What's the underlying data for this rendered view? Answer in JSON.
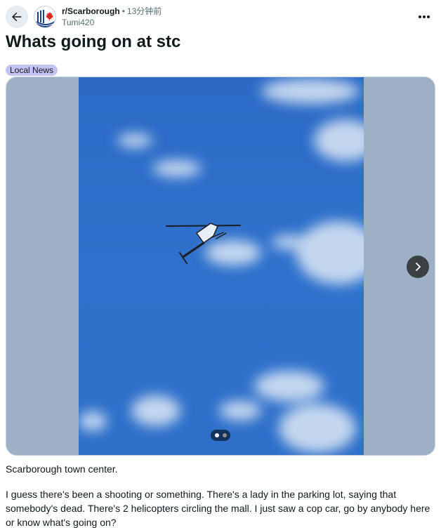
{
  "header": {
    "subreddit": "r/Scarborough",
    "separator": "•",
    "time_ago": "13分钟前",
    "author": "Tumi420",
    "icons": {
      "back": "back-arrow-icon",
      "more": "more-options-icon",
      "avatar": "subreddit-avatar-icon"
    }
  },
  "post": {
    "title": "Whats going on at stc",
    "flair": "Local News",
    "gallery": {
      "current_page": 1,
      "total_pages": 2,
      "next_icon": "chevron-right-icon"
    },
    "body": [
      "Scarborough town center.",
      "I guess there's been a shooting or something. There's a lady in the parking lot, saying that somebody's dead. There's 2 helicopters circling the mall. I just saw a cop car, go by anybody here or know what's going on?"
    ]
  },
  "colors": {
    "flair_bg": "#c2c3f0",
    "sky": "#2f6fc9",
    "gallery_side": "#9eb0c5"
  }
}
